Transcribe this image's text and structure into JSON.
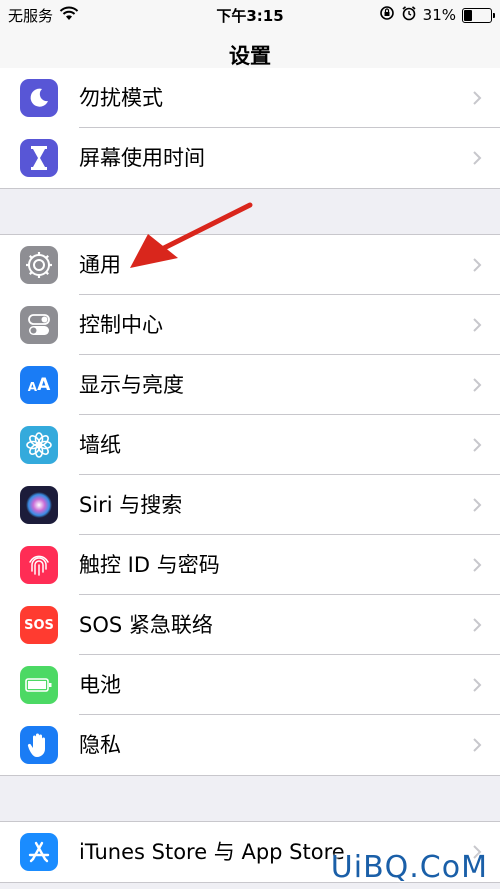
{
  "status_bar": {
    "carrier": "无服务",
    "time": "下午3:15",
    "battery_percent": "31%",
    "battery_level": 0.31
  },
  "nav": {
    "title": "设置"
  },
  "groups": [
    {
      "items": [
        {
          "label": "勿扰模式",
          "icon": "moon-icon",
          "color": "#5856d6"
        },
        {
          "label": "屏幕使用时间",
          "icon": "hourglass-icon",
          "color": "#5856d6"
        }
      ]
    },
    {
      "items": [
        {
          "label": "通用",
          "icon": "gear-icon",
          "color": "#8e8e93"
        },
        {
          "label": "控制中心",
          "icon": "toggle-icon",
          "color": "#8e8e93"
        },
        {
          "label": "显示与亮度",
          "icon": "text-size-icon",
          "color": "#1a7cf5"
        },
        {
          "label": "墙纸",
          "icon": "flower-icon",
          "color": "#34aadc"
        },
        {
          "label": "Siri 与搜索",
          "icon": "siri-icon",
          "color": "#1c1c3a"
        },
        {
          "label": "触控 ID 与密码",
          "icon": "fingerprint-icon",
          "color": "#ff2d55"
        },
        {
          "label": "SOS 紧急联络",
          "icon": "sos-icon",
          "color": "#ff3b30",
          "icon_text": "SOS"
        },
        {
          "label": "电池",
          "icon": "battery-icon",
          "color": "#4cd964"
        },
        {
          "label": "隐私",
          "icon": "hand-icon",
          "color": "#1a7cf5"
        }
      ]
    },
    {
      "items": [
        {
          "label": "iTunes Store 与 App Store",
          "icon": "app-store-icon",
          "color": "#1a8cff"
        }
      ]
    }
  ],
  "watermark": "UiBQ.CoM",
  "annotation_arrow_color": "#d9261c"
}
